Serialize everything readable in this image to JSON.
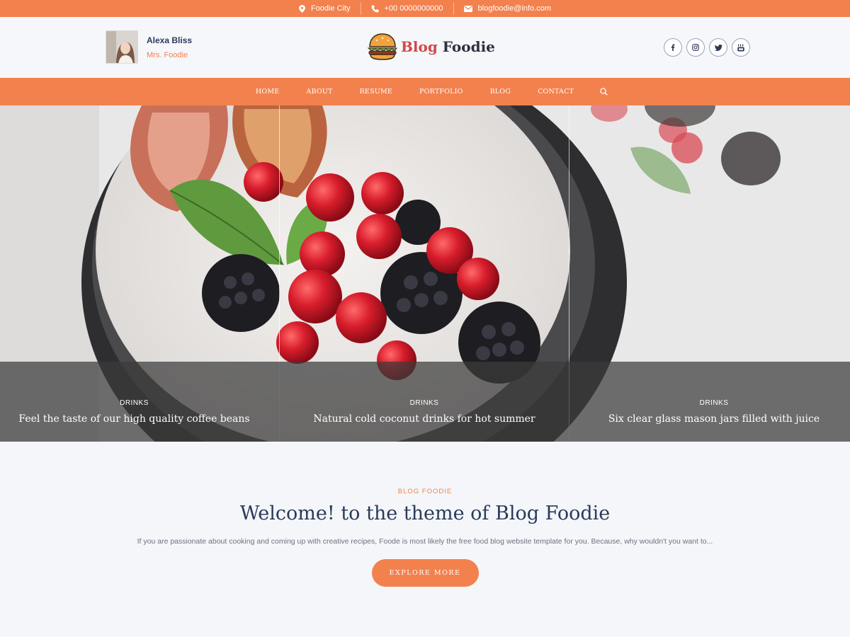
{
  "topbar": {
    "location": "Foodie City",
    "phone": "+00 0000000000",
    "email": "blogfoodie@info.com",
    "icons": [
      "map-pin-icon",
      "phone-icon",
      "mail-icon"
    ]
  },
  "profile": {
    "name": "Alexa Bliss",
    "role": "Mrs. Foodie"
  },
  "logo": {
    "part1": "Blog",
    "part2": "Foodie",
    "icon": "burger-icon"
  },
  "socials": [
    "facebook-icon",
    "instagram-icon",
    "twitter-icon",
    "youtube-icon"
  ],
  "nav": {
    "items": [
      "HOME",
      "ABOUT",
      "RESUME",
      "PORTFOLIO",
      "BLOG",
      "CONTACT"
    ],
    "search_icon": "search-icon"
  },
  "slides": [
    {
      "category": "DRINKS",
      "title": "Feel the taste of our high quality coffee beans"
    },
    {
      "category": "DRINKS",
      "title": "Natural cold coconut drinks for hot summer"
    },
    {
      "category": "DRINKS",
      "title": "Six clear glass mason jars filled with juice"
    }
  ],
  "welcome": {
    "kicker": "BLOG FOODIE",
    "heading": "Welcome! to the theme of Blog Foodie",
    "description": "If you are passionate about cooking and coming up with creative recipes, Foode is most likely the free food blog website template for you. Because, why wouldn't you want to...",
    "button": "EXPLORE MORE"
  },
  "colors": {
    "accent": "#f2814e",
    "heading": "#2a3a5a",
    "background": "#f4f6f9"
  }
}
